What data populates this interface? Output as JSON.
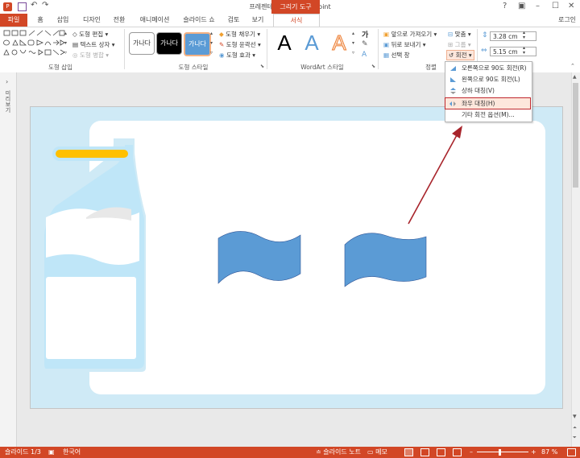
{
  "window": {
    "title": "프레젠테이션1 - PowerPoint",
    "context_tab_group": "그리기 도구",
    "login": "로그인"
  },
  "tabs": [
    "파일",
    "홈",
    "삽입",
    "디자인",
    "전환",
    "애니메이션",
    "슬라이드 쇼",
    "검토",
    "보기",
    "서식"
  ],
  "ribbon": {
    "insert_shapes": {
      "label": "도형 삽입",
      "edit_shape": "도형 편집",
      "text_box": "텍스트 상자",
      "merge_shapes": "도형 병합"
    },
    "shape_styles": {
      "label": "도형 스타일",
      "presets": [
        "가나다",
        "가나다",
        "가나다"
      ],
      "fill": "도형 채우기",
      "outline": "도형 윤곽선",
      "effects": "도형 효과"
    },
    "wordart": {
      "label": "WordArt 스타일",
      "samples": [
        "A",
        "A",
        "A"
      ]
    },
    "arrange": {
      "label": "정렬",
      "bring_forward": "앞으로 가져오기",
      "send_backward": "뒤로 보내기",
      "selection_pane": "선택 창",
      "align": "맞춤",
      "group": "그룹",
      "rotate": "회전"
    },
    "size": {
      "height": "3.28 cm",
      "width": "5.15 cm"
    }
  },
  "rotate_menu": {
    "items": [
      "오른쪽으로 90도 회전(R)",
      "왼쪽으로 90도 회전(L)",
      "상하 대칭(V)",
      "좌우 대칭(H)",
      "기타 회전 옵션(M)..."
    ],
    "highlighted_index": 3
  },
  "left_panel": {
    "label": "미리보기"
  },
  "status": {
    "slide": "슬라이드 1/3",
    "language": "한국어",
    "notes": "슬라이드 노트",
    "comments": "메모",
    "zoom": "87 %"
  },
  "colors": {
    "accent": "#d24726",
    "slide_bg": "#cfeaf6",
    "shape_fill": "#5b9bd5",
    "bottle_cap": "#ffc000",
    "arrow": "#a8242b"
  }
}
